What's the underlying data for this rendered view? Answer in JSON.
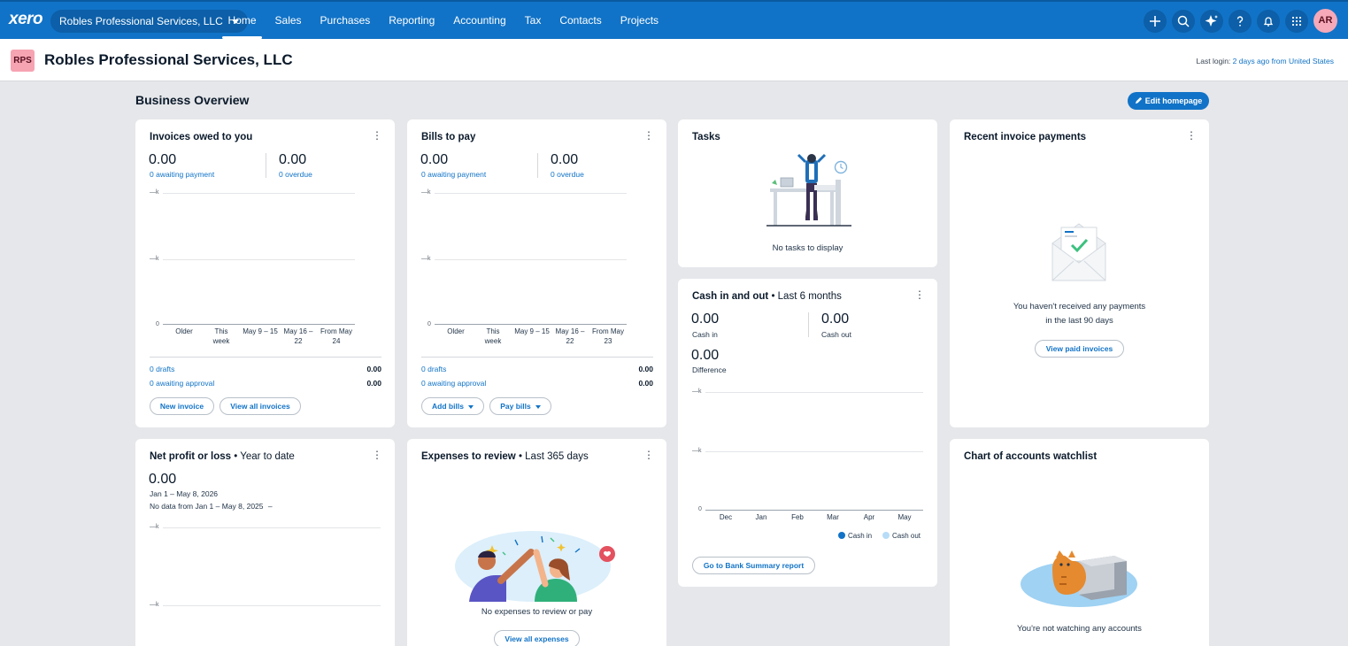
{
  "nav": {
    "logo": "xero",
    "org_name": "Robles Professional Services, LLC",
    "links": [
      "Home",
      "Sales",
      "Purchases",
      "Reporting",
      "Accounting",
      "Tax",
      "Contacts",
      "Projects"
    ],
    "active": "Home",
    "icons": [
      "plus-icon",
      "search-icon",
      "sparkle-icon",
      "help-icon",
      "bell-icon",
      "apps-grid-icon"
    ],
    "avatar": "AR"
  },
  "org": {
    "badge": "RPS",
    "title": "Robles Professional Services, LLC",
    "last_login_label": "Last login:",
    "last_login_value": "2 days ago from United States"
  },
  "overview": {
    "title": "Business Overview",
    "edit_button": "Edit homepage"
  },
  "invoices": {
    "title": "Invoices owed to you",
    "awaiting_amount": "0.00",
    "awaiting_label": "0 awaiting payment",
    "overdue_amount": "0.00",
    "overdue_label": "0 overdue",
    "ticks": [
      "—k",
      "—k",
      "0"
    ],
    "x_labels": [
      "Older",
      "This week",
      "May 9 – 15",
      "May 16 – 22",
      "From May 24"
    ],
    "drafts_label": "0 drafts",
    "drafts_value": "0.00",
    "approval_label": "0 awaiting approval",
    "approval_value": "0.00",
    "btn_new": "New invoice",
    "btn_view": "View all invoices"
  },
  "bills": {
    "title": "Bills to pay",
    "awaiting_amount": "0.00",
    "awaiting_label": "0 awaiting payment",
    "overdue_amount": "0.00",
    "overdue_label": "0 overdue",
    "ticks": [
      "—k",
      "—k",
      "0"
    ],
    "x_labels": [
      "Older",
      "This week",
      "May 9 – 15",
      "May 16 – 22",
      "From May 23"
    ],
    "drafts_label": "0 drafts",
    "drafts_value": "0.00",
    "approval_label": "0 awaiting approval",
    "approval_value": "0.00",
    "btn_add": "Add bills",
    "btn_pay": "Pay bills"
  },
  "tasks": {
    "title": "Tasks",
    "empty": "No tasks to display"
  },
  "cash": {
    "title": "Cash in and out",
    "subtitle": " • Last 6 months",
    "in_amount": "0.00",
    "in_label": "Cash in",
    "out_amount": "0.00",
    "out_label": "Cash out",
    "diff_amount": "0.00",
    "diff_label": "Difference",
    "ticks": [
      "—k",
      "—k",
      "0"
    ],
    "months": [
      "Dec",
      "Jan",
      "Feb",
      "Mar",
      "Apr",
      "May"
    ],
    "legend_in": "Cash in",
    "legend_out": "Cash out",
    "color_in": "#1173c7",
    "color_out": "#b7dcf7",
    "btn": "Go to Bank Summary report"
  },
  "recent": {
    "title": "Recent invoice payments",
    "empty_line1": "You haven't received any payments",
    "empty_line2": "in the last 90 days",
    "btn": "View paid invoices"
  },
  "profit": {
    "title": "Net profit or loss",
    "subtitle": " • Year to date",
    "amount": "0.00",
    "range": "Jan 1 – May 8, 2026",
    "nodata": "No data from Jan 1 – May 8, 2025",
    "nodata_dash": "–",
    "ticks": [
      "—k",
      "—k"
    ]
  },
  "expenses": {
    "title": "Expenses to review",
    "subtitle": " • Last 365 days",
    "empty": "No expenses to review or pay",
    "btn": "View all expenses"
  },
  "watchlist": {
    "title": "Chart of accounts watchlist",
    "empty": "You're not watching any accounts"
  }
}
